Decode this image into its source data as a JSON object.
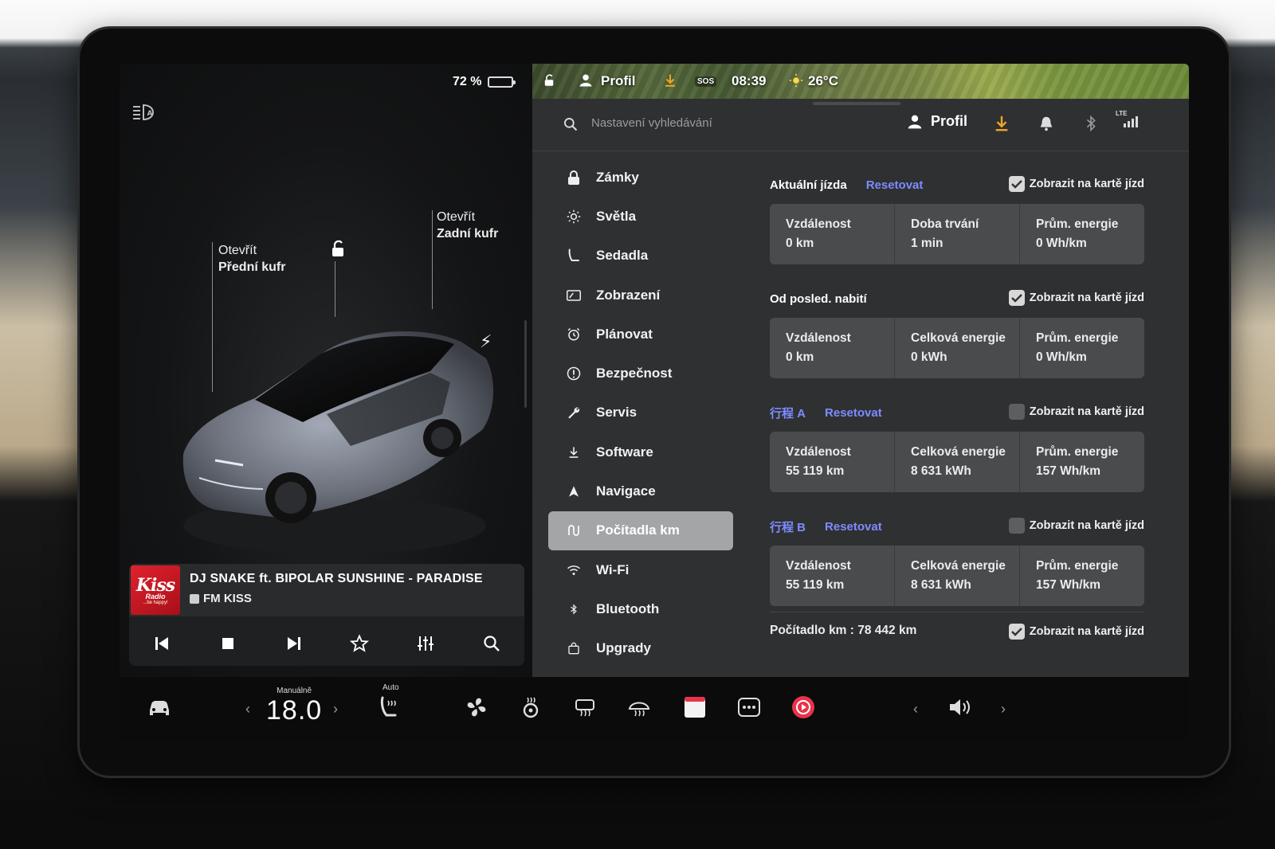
{
  "battery": {
    "percent_label": "72 %",
    "level": 0.72
  },
  "car_labels": {
    "frunk_line1": "Otevřít",
    "frunk_line2": "Přední kufr",
    "trunk_line1": "Otevřít",
    "trunk_line2": "Zadní kufr"
  },
  "media": {
    "logo_text": "Kiss",
    "logo_sub": "Radio",
    "logo_tagline": "...be happy!",
    "song": "DJ SNAKE ft. BIPOLAR SUNSHINE - PARADISE",
    "station": "FM KISS",
    "controls": [
      "prev-icon",
      "stop-icon",
      "next-icon",
      "favorite-icon",
      "equalizer-icon",
      "search-icon"
    ]
  },
  "status_bar": {
    "profile": "Profil",
    "sos": "SOS",
    "time": "08:39",
    "temperature": "26°C"
  },
  "topbar": {
    "search_placeholder": "Nastavení vyhledávání",
    "profile": "Profil",
    "signal": "LTE"
  },
  "nav": {
    "items": [
      {
        "label": "Zámky",
        "icon": "lock-icon"
      },
      {
        "label": "Světla",
        "icon": "sun-icon"
      },
      {
        "label": "Sedadla",
        "icon": "seat-icon"
      },
      {
        "label": "Zobrazení",
        "icon": "display-icon"
      },
      {
        "label": "Plánovat",
        "icon": "alarm-clock-icon"
      },
      {
        "label": "Bezpečnost",
        "icon": "safety-icon"
      },
      {
        "label": "Servis",
        "icon": "wrench-icon"
      },
      {
        "label": "Software",
        "icon": "download-icon"
      },
      {
        "label": "Navigace",
        "icon": "navigation-icon"
      },
      {
        "label": "Počítadla km",
        "icon": "trips-icon"
      },
      {
        "label": "Wi-Fi",
        "icon": "wifi-icon"
      },
      {
        "label": "Bluetooth",
        "icon": "bluetooth-icon"
      },
      {
        "label": "Upgrady",
        "icon": "shopping-bag-icon"
      }
    ],
    "active_index": 9
  },
  "trips": {
    "show_label": "Zobrazit na kartě jízd",
    "reset_label": "Resetovat",
    "sections": [
      {
        "title": "Aktuální jízda",
        "title_color": "white",
        "has_reset": true,
        "show_checked": true,
        "cells": [
          {
            "label": "Vzdálenost",
            "value": "0 km"
          },
          {
            "label": "Doba trvání",
            "value": "1 min"
          },
          {
            "label": "Prům. energie",
            "value": "0 Wh/km"
          }
        ]
      },
      {
        "title": "Od posled. nabití",
        "title_color": "white",
        "has_reset": false,
        "show_checked": true,
        "cells": [
          {
            "label": "Vzdálenost",
            "value": "0 km"
          },
          {
            "label": "Celková energie",
            "value": "0 kWh"
          },
          {
            "label": "Prům. energie",
            "value": "0 Wh/km"
          }
        ]
      },
      {
        "title": "行程 A",
        "title_color": "blue",
        "has_reset": true,
        "show_checked": false,
        "cells": [
          {
            "label": "Vzdálenost",
            "value": "55 119 km"
          },
          {
            "label": "Celková energie",
            "value": "8 631 kWh"
          },
          {
            "label": "Prům. energie",
            "value": "157 Wh/km"
          }
        ]
      },
      {
        "title": "行程 B",
        "title_color": "blue",
        "has_reset": true,
        "show_checked": false,
        "cells": [
          {
            "label": "Vzdálenost",
            "value": "55 119 km"
          },
          {
            "label": "Celková energie",
            "value": "8 631 kWh"
          },
          {
            "label": "Prům. energie",
            "value": "157 Wh/km"
          }
        ]
      }
    ],
    "odometer": {
      "label": "Počítadlo km",
      "separator": " : ",
      "value": "78 442 km",
      "show_checked": true
    }
  },
  "dock": {
    "climate_mode": "Manuálně",
    "temperature": "18.0",
    "seat_heat_mode": "Auto",
    "left_arrow": "‹",
    "right_arrow": "›"
  },
  "colors": {
    "accent_blue": "#7d8cff",
    "orange_download": "#f5a623",
    "record_red": "#e8334a",
    "active_nav": "#a4a5a7"
  }
}
